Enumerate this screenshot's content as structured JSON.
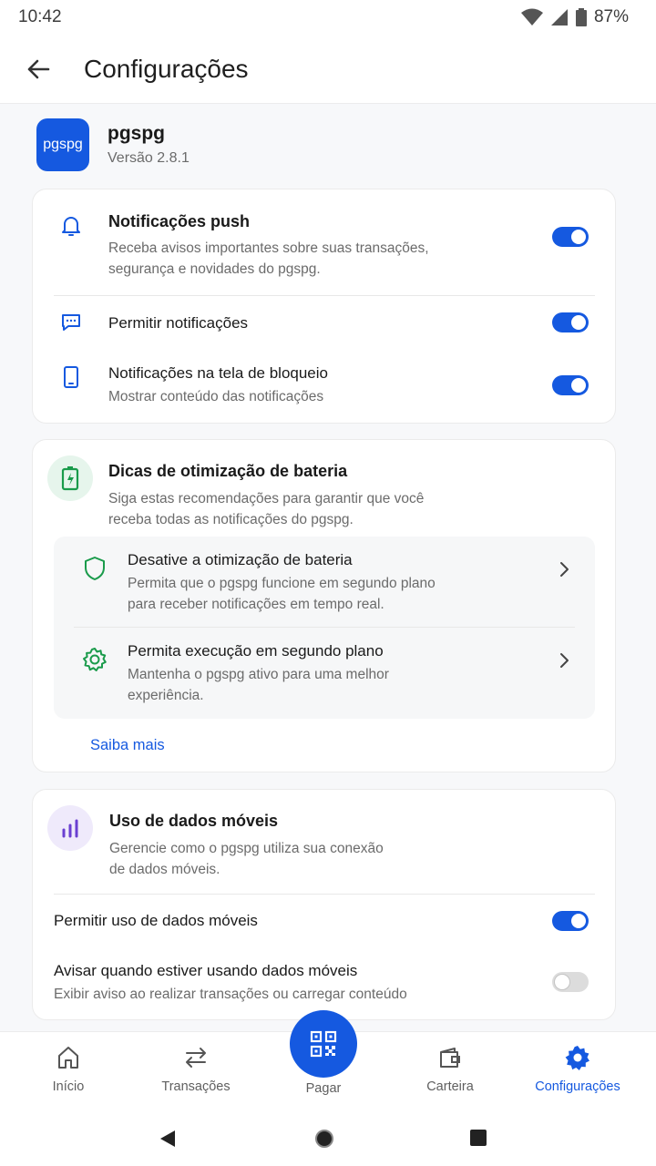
{
  "status_bar": {
    "time": "10:42",
    "battery": "87%"
  },
  "app_bar": {
    "title": "Configurações"
  },
  "app_info": {
    "logo_text": "pgspg",
    "name": "pgspg",
    "version": "Versão 2.8.1"
  },
  "notifications_card": {
    "push": {
      "title": "Notificações push",
      "desc_line1": "Receba avisos importantes sobre suas transações,",
      "desc_line2": "segurança e novidades do pgspg.",
      "enabled": true
    },
    "allow": {
      "title": "Permitir notificações",
      "enabled": true
    },
    "lockscreen": {
      "title": "Notificações na tela de bloqueio",
      "desc": "Mostrar conteúdo das notificações",
      "enabled": true
    }
  },
  "battery_card": {
    "title": "Dicas de otimização de bateria",
    "desc_line1": "Siga estas recomendações para garantir que você",
    "desc_line2": "receba todas as notificações do pgspg.",
    "tips": [
      {
        "title": "Desative a otimização de bateria",
        "desc_line1": "Permita que o pgspg funcione em segundo plano",
        "desc_line2": "para receber notificações em tempo real.",
        "icon": "shield-icon"
      },
      {
        "title": "Permita execução em segundo plano",
        "desc_line1": "Mantenha o pgspg ativo para uma melhor",
        "desc_line2": "experiência.",
        "icon": "gear-icon"
      }
    ],
    "learn_more": "Saiba mais",
    "accent": "#1a9b4b"
  },
  "data_card": {
    "title": "Uso de dados móveis",
    "desc_line1": "Gerencie como o pgspg utiliza sua conexão",
    "desc_line2": "de dados móveis.",
    "allow": {
      "title": "Permitir uso de dados móveis",
      "enabled": true
    },
    "warn": {
      "title": "Avisar quando estiver usando dados móveis",
      "desc": "Exibir aviso ao realizar transações ou carregar conteúdo",
      "enabled": false
    },
    "accent": "#6a3fd1"
  },
  "bottom_nav": {
    "items": [
      {
        "label": "Início",
        "icon": "home-icon",
        "active": false
      },
      {
        "label": "Transações",
        "icon": "transfer-icon",
        "active": false
      },
      {
        "label": "Pagar",
        "icon": "qr-code-icon",
        "active": false
      },
      {
        "label": "Carteira",
        "icon": "wallet-icon",
        "active": false
      },
      {
        "label": "Configurações",
        "icon": "gear-icon",
        "active": true
      }
    ]
  },
  "colors": {
    "primary": "#1559e0",
    "text": "#1a1a1a",
    "muted": "#6b6b6b"
  }
}
